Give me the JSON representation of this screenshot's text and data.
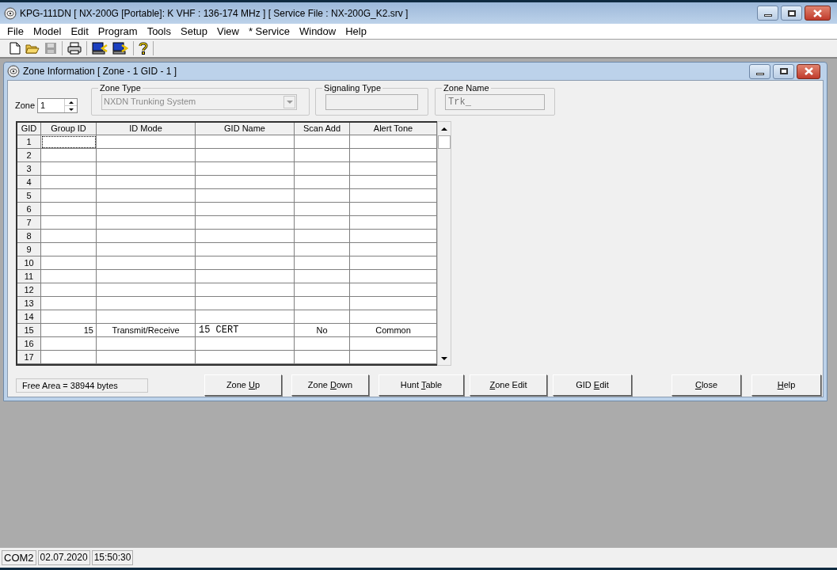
{
  "window": {
    "title": "KPG-111DN  [ NX-200G  [Portable]: K VHF : 136-174 MHz ] [ Service File : NX-200G_K2.srv ]"
  },
  "menu": [
    "File",
    "Model",
    "Edit",
    "Program",
    "Tools",
    "Setup",
    "View",
    "* Service",
    "Window",
    "Help"
  ],
  "child": {
    "title": "Zone Information [ Zone - 1  GID - 1 ]",
    "zone": {
      "label": "Zone",
      "value": "1"
    },
    "zone_type": {
      "label": "Zone Type",
      "value": "NXDN Trunking System",
      "disabled": true
    },
    "signaling_type": {
      "label": "Signaling Type"
    },
    "zone_name": {
      "label": "Zone Name",
      "value": "Trk_",
      "disabled": true
    },
    "table": {
      "columns": [
        "GID",
        "Group ID",
        "ID Mode",
        "GID Name",
        "Scan Add",
        "Alert Tone"
      ],
      "rows": [
        {
          "gid": "1",
          "focused": true
        },
        {
          "gid": "2",
          "focused": false
        },
        {
          "gid": "3",
          "focused": false
        },
        {
          "gid": "4",
          "focused": false
        },
        {
          "gid": "5",
          "focused": false
        },
        {
          "gid": "6",
          "focused": false
        },
        {
          "gid": "7",
          "focused": false
        },
        {
          "gid": "8",
          "focused": false
        },
        {
          "gid": "9",
          "focused": false
        },
        {
          "gid": "10",
          "focused": false
        },
        {
          "gid": "11",
          "focused": false
        },
        {
          "gid": "12",
          "focused": false
        },
        {
          "gid": "13",
          "focused": false
        },
        {
          "gid": "14",
          "focused": false
        },
        {
          "gid": "15",
          "focused": false,
          "group_id": "15",
          "id_mode": "Transmit/Receive",
          "gid_name": "15  CERT",
          "scan_add": "No",
          "alert_tone": "Common"
        },
        {
          "gid": "16",
          "focused": false
        },
        {
          "gid": "17",
          "focused": false
        }
      ]
    },
    "free_area": "Free Area = 38944 bytes",
    "buttons": [
      {
        "pre": "Zone ",
        "key": "U",
        "post": "p"
      },
      {
        "pre": "Zone ",
        "key": "D",
        "post": "own"
      },
      {
        "pre": "Hunt ",
        "key": "T",
        "post": "able"
      },
      {
        "key": "Z",
        "post": "one Edit"
      },
      {
        "pre": "GID ",
        "key": "E",
        "post": "dit"
      },
      {
        "key": "C",
        "post": "lose"
      },
      {
        "key": "H",
        "post": "elp"
      }
    ]
  },
  "status_bar": [
    "COM2",
    "02.07.2020",
    "15:50:30"
  ]
}
